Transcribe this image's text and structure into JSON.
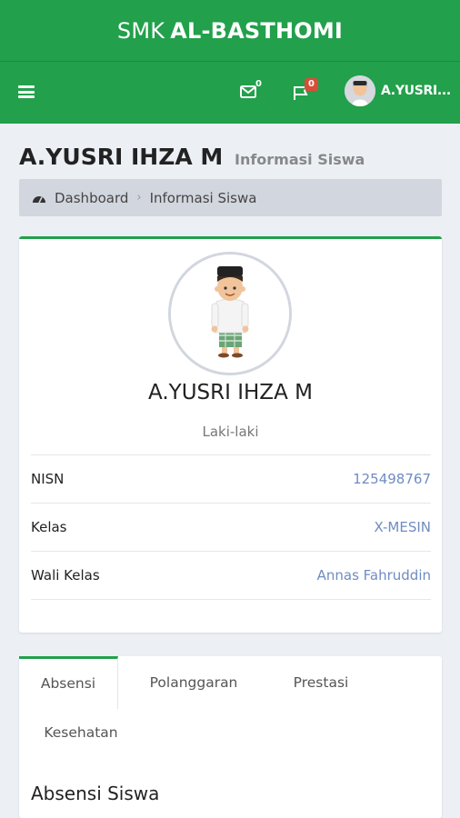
{
  "brand": {
    "prefix": "SMK",
    "name": "AL-BASTHOMI"
  },
  "navbar": {
    "messages_count": "0",
    "notifications_count": "0",
    "user_name": "A.YUSRI..."
  },
  "header": {
    "title": "A.YUSRI IHZA M",
    "subtitle": "Informasi Siswa"
  },
  "breadcrumb": {
    "home": "Dashboard",
    "current": "Informasi Siswa"
  },
  "profile": {
    "name": "A.YUSRI IHZA M",
    "gender": "Laki-laki",
    "fields": [
      {
        "label": "NISN",
        "value": "125498767"
      },
      {
        "label": "Kelas",
        "value": "X-MESIN"
      },
      {
        "label": "Wali Kelas",
        "value": "Annas Fahruddin"
      }
    ]
  },
  "tabs": [
    {
      "label": "Absensi",
      "active": true
    },
    {
      "label": "Polanggaran",
      "active": false
    },
    {
      "label": "Prestasi",
      "active": false
    },
    {
      "label": "Kesehatan",
      "active": false
    }
  ],
  "tab_content": {
    "title": "Absensi Siswa"
  },
  "colors": {
    "primary": "#22a04b",
    "badge": "#dd4b39",
    "link_value": "#6f8cc1",
    "background": "#ecf0f5"
  }
}
